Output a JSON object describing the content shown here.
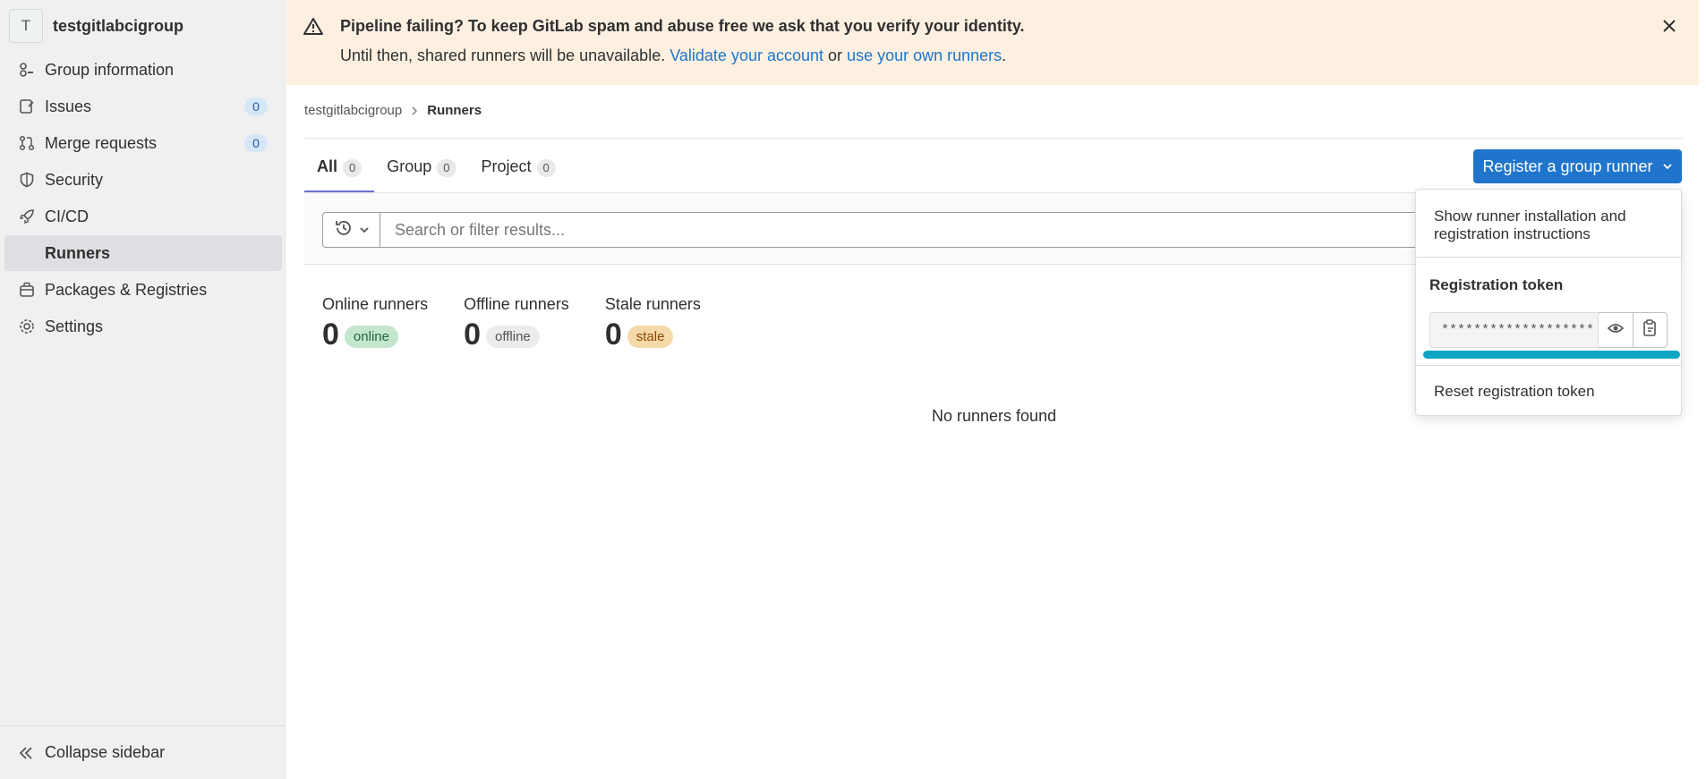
{
  "sidebar": {
    "avatar_letter": "T",
    "group_name": "testgitlabcigroup",
    "items": [
      {
        "label": "Group information",
        "icon": "group-info-icon"
      },
      {
        "label": "Issues",
        "icon": "issues-icon",
        "count": "0"
      },
      {
        "label": "Merge requests",
        "icon": "merge-request-icon",
        "count": "0"
      },
      {
        "label": "Security",
        "icon": "shield-icon"
      },
      {
        "label": "CI/CD",
        "icon": "rocket-icon"
      },
      {
        "label": "Runners",
        "active": true,
        "sub": true
      },
      {
        "label": "Packages & Registries",
        "icon": "package-icon"
      },
      {
        "label": "Settings",
        "icon": "gear-icon"
      }
    ],
    "collapse_label": "Collapse sidebar"
  },
  "alert": {
    "title": "Pipeline failing? To keep GitLab spam and abuse free we ask that you verify your identity.",
    "body_prefix": "Until then, shared runners will be unavailable.",
    "link_validate": "Validate your account",
    "or_text": "or",
    "link_runners": "use your own runners",
    "suffix": "."
  },
  "breadcrumb": {
    "group": "testgitlabcigroup",
    "current": "Runners"
  },
  "tabs": [
    {
      "label": "All",
      "count": "0",
      "active": true
    },
    {
      "label": "Group",
      "count": "0"
    },
    {
      "label": "Project",
      "count": "0"
    }
  ],
  "register_button": {
    "label": "Register a group runner"
  },
  "search": {
    "placeholder": "Search or filter results..."
  },
  "stats": [
    {
      "label": "Online runners",
      "value": "0",
      "badge": "online"
    },
    {
      "label": "Offline runners",
      "value": "0",
      "badge": "offline"
    },
    {
      "label": "Stale runners",
      "value": "0",
      "badge": "stale"
    }
  ],
  "empty_text": "No runners found",
  "dropdown": {
    "instructions": "Show runner installation and registration instructions",
    "token_title": "Registration token",
    "token_value": "*******************",
    "reset_label": "Reset registration token"
  },
  "colors": {
    "primary": "#1f75cb",
    "alert_bg": "#fdf0e1",
    "focus_ring": "#0ea5c4",
    "active_tab": "#6f6fd1"
  }
}
